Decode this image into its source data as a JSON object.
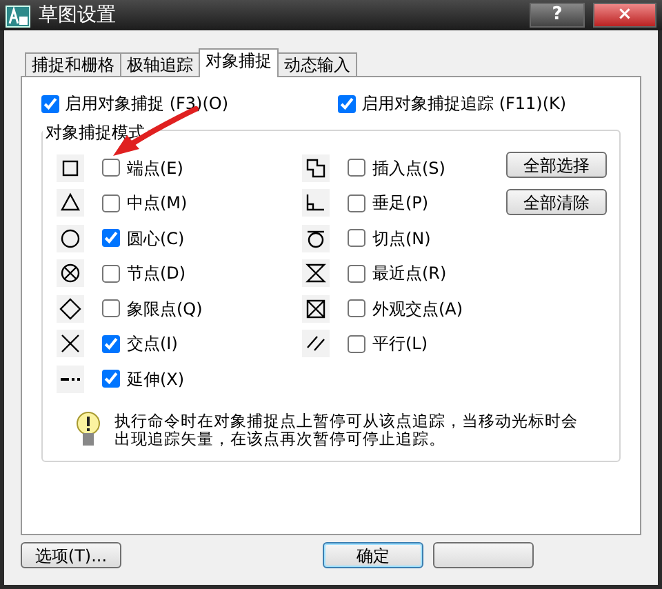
{
  "window": {
    "title": "草图设置",
    "help_button": "?",
    "close_button": "×"
  },
  "tabs": [
    {
      "label": "捕捉和栅格",
      "selected": false
    },
    {
      "label": "极轴追踪",
      "selected": false
    },
    {
      "label": "对象捕捉",
      "selected": true
    },
    {
      "label": "动态输入",
      "selected": false
    }
  ],
  "enable_options": [
    {
      "label": "启用对象捕捉 (F3)(O)",
      "checked": true
    },
    {
      "label": "启用对象捕捉追踪 (F11)(K)",
      "checked": true
    }
  ],
  "snap_modes": {
    "title": "对象捕捉模式",
    "left": [
      {
        "label": "端点(E)",
        "checked": false
      },
      {
        "label": "中点(M)",
        "checked": false
      },
      {
        "label": "圆心(C)",
        "checked": true
      },
      {
        "label": "节点(D)",
        "checked": false
      },
      {
        "label": "象限点(Q)",
        "checked": false
      },
      {
        "label": "交点(I)",
        "checked": true
      },
      {
        "label": "延伸(X)",
        "checked": true
      }
    ],
    "right": [
      {
        "label": "插入点(S)",
        "checked": false
      },
      {
        "label": "垂足(P)",
        "checked": false
      },
      {
        "label": "切点(N)",
        "checked": false
      },
      {
        "label": "最近点(R)",
        "checked": false
      },
      {
        "label": "外观交点(A)",
        "checked": false
      },
      {
        "label": "平行(L)",
        "checked": false
      }
    ],
    "buttons": [
      "全部选择",
      "全部清除"
    ],
    "hint": "执行命令时在对象捕捉点上暂停可从该点追踪，当移动光标时会出现追踪矢量，在该点再次暂停可停止追踪。"
  },
  "footer": {
    "options_button": "选项(T)...",
    "ok_button": "确定"
  }
}
